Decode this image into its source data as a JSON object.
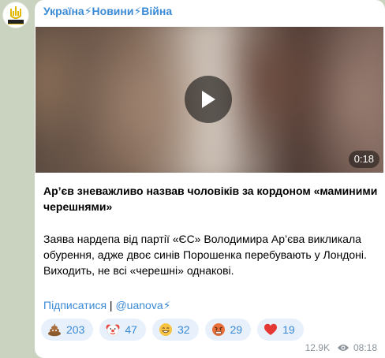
{
  "channel": {
    "name": "Україна⚡Новини⚡Війна"
  },
  "video": {
    "duration": "0:18"
  },
  "post": {
    "headline": "Ар’єв зневажливо назвав чоловіків за кордоном «маминими черешнями»",
    "body": "Заява нардепа від партії «ЄС» Володимира Ар’єва викликала обурення, адже двоє синів Порошенка перебувають у Лондоні. Виходить, не всі «черешні» однакові.",
    "subscribe_link": "Підписатися",
    "separator": " | ",
    "channel_link": "@uanova⚡"
  },
  "reactions": [
    {
      "emoji": "poo",
      "count": "203"
    },
    {
      "emoji": "clown",
      "count": "47"
    },
    {
      "emoji": "grin",
      "count": "32"
    },
    {
      "emoji": "angry",
      "count": "29"
    },
    {
      "emoji": "heart",
      "count": "19"
    }
  ],
  "meta": {
    "views": "12.9K",
    "time": "08:18"
  }
}
